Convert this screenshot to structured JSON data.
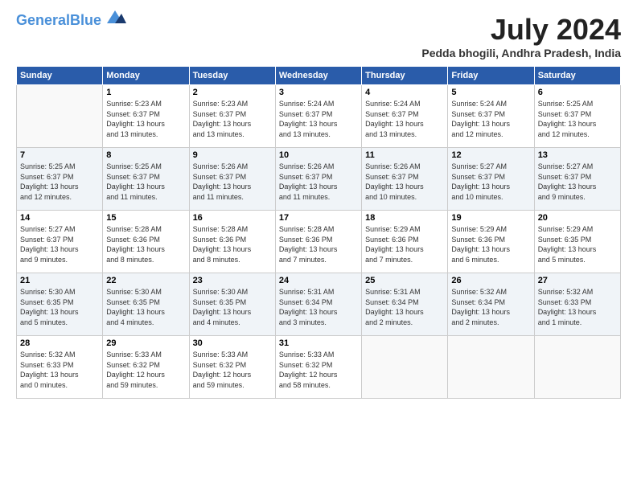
{
  "header": {
    "logo_line1": "General",
    "logo_line2": "Blue",
    "title": "July 2024",
    "location": "Pedda bhogili, Andhra Pradesh, India"
  },
  "days_of_week": [
    "Sunday",
    "Monday",
    "Tuesday",
    "Wednesday",
    "Thursday",
    "Friday",
    "Saturday"
  ],
  "weeks": [
    [
      {
        "day": "",
        "detail": ""
      },
      {
        "day": "1",
        "detail": "Sunrise: 5:23 AM\nSunset: 6:37 PM\nDaylight: 13 hours\nand 13 minutes."
      },
      {
        "day": "2",
        "detail": "Sunrise: 5:23 AM\nSunset: 6:37 PM\nDaylight: 13 hours\nand 13 minutes."
      },
      {
        "day": "3",
        "detail": "Sunrise: 5:24 AM\nSunset: 6:37 PM\nDaylight: 13 hours\nand 13 minutes."
      },
      {
        "day": "4",
        "detail": "Sunrise: 5:24 AM\nSunset: 6:37 PM\nDaylight: 13 hours\nand 13 minutes."
      },
      {
        "day": "5",
        "detail": "Sunrise: 5:24 AM\nSunset: 6:37 PM\nDaylight: 13 hours\nand 12 minutes."
      },
      {
        "day": "6",
        "detail": "Sunrise: 5:25 AM\nSunset: 6:37 PM\nDaylight: 13 hours\nand 12 minutes."
      }
    ],
    [
      {
        "day": "7",
        "detail": "Sunrise: 5:25 AM\nSunset: 6:37 PM\nDaylight: 13 hours\nand 12 minutes."
      },
      {
        "day": "8",
        "detail": "Sunrise: 5:25 AM\nSunset: 6:37 PM\nDaylight: 13 hours\nand 11 minutes."
      },
      {
        "day": "9",
        "detail": "Sunrise: 5:26 AM\nSunset: 6:37 PM\nDaylight: 13 hours\nand 11 minutes."
      },
      {
        "day": "10",
        "detail": "Sunrise: 5:26 AM\nSunset: 6:37 PM\nDaylight: 13 hours\nand 11 minutes."
      },
      {
        "day": "11",
        "detail": "Sunrise: 5:26 AM\nSunset: 6:37 PM\nDaylight: 13 hours\nand 10 minutes."
      },
      {
        "day": "12",
        "detail": "Sunrise: 5:27 AM\nSunset: 6:37 PM\nDaylight: 13 hours\nand 10 minutes."
      },
      {
        "day": "13",
        "detail": "Sunrise: 5:27 AM\nSunset: 6:37 PM\nDaylight: 13 hours\nand 9 minutes."
      }
    ],
    [
      {
        "day": "14",
        "detail": "Sunrise: 5:27 AM\nSunset: 6:37 PM\nDaylight: 13 hours\nand 9 minutes."
      },
      {
        "day": "15",
        "detail": "Sunrise: 5:28 AM\nSunset: 6:36 PM\nDaylight: 13 hours\nand 8 minutes."
      },
      {
        "day": "16",
        "detail": "Sunrise: 5:28 AM\nSunset: 6:36 PM\nDaylight: 13 hours\nand 8 minutes."
      },
      {
        "day": "17",
        "detail": "Sunrise: 5:28 AM\nSunset: 6:36 PM\nDaylight: 13 hours\nand 7 minutes."
      },
      {
        "day": "18",
        "detail": "Sunrise: 5:29 AM\nSunset: 6:36 PM\nDaylight: 13 hours\nand 7 minutes."
      },
      {
        "day": "19",
        "detail": "Sunrise: 5:29 AM\nSunset: 6:36 PM\nDaylight: 13 hours\nand 6 minutes."
      },
      {
        "day": "20",
        "detail": "Sunrise: 5:29 AM\nSunset: 6:35 PM\nDaylight: 13 hours\nand 5 minutes."
      }
    ],
    [
      {
        "day": "21",
        "detail": "Sunrise: 5:30 AM\nSunset: 6:35 PM\nDaylight: 13 hours\nand 5 minutes."
      },
      {
        "day": "22",
        "detail": "Sunrise: 5:30 AM\nSunset: 6:35 PM\nDaylight: 13 hours\nand 4 minutes."
      },
      {
        "day": "23",
        "detail": "Sunrise: 5:30 AM\nSunset: 6:35 PM\nDaylight: 13 hours\nand 4 minutes."
      },
      {
        "day": "24",
        "detail": "Sunrise: 5:31 AM\nSunset: 6:34 PM\nDaylight: 13 hours\nand 3 minutes."
      },
      {
        "day": "25",
        "detail": "Sunrise: 5:31 AM\nSunset: 6:34 PM\nDaylight: 13 hours\nand 2 minutes."
      },
      {
        "day": "26",
        "detail": "Sunrise: 5:32 AM\nSunset: 6:34 PM\nDaylight: 13 hours\nand 2 minutes."
      },
      {
        "day": "27",
        "detail": "Sunrise: 5:32 AM\nSunset: 6:33 PM\nDaylight: 13 hours\nand 1 minute."
      }
    ],
    [
      {
        "day": "28",
        "detail": "Sunrise: 5:32 AM\nSunset: 6:33 PM\nDaylight: 13 hours\nand 0 minutes."
      },
      {
        "day": "29",
        "detail": "Sunrise: 5:33 AM\nSunset: 6:32 PM\nDaylight: 12 hours\nand 59 minutes."
      },
      {
        "day": "30",
        "detail": "Sunrise: 5:33 AM\nSunset: 6:32 PM\nDaylight: 12 hours\nand 59 minutes."
      },
      {
        "day": "31",
        "detail": "Sunrise: 5:33 AM\nSunset: 6:32 PM\nDaylight: 12 hours\nand 58 minutes."
      },
      {
        "day": "",
        "detail": ""
      },
      {
        "day": "",
        "detail": ""
      },
      {
        "day": "",
        "detail": ""
      }
    ]
  ]
}
